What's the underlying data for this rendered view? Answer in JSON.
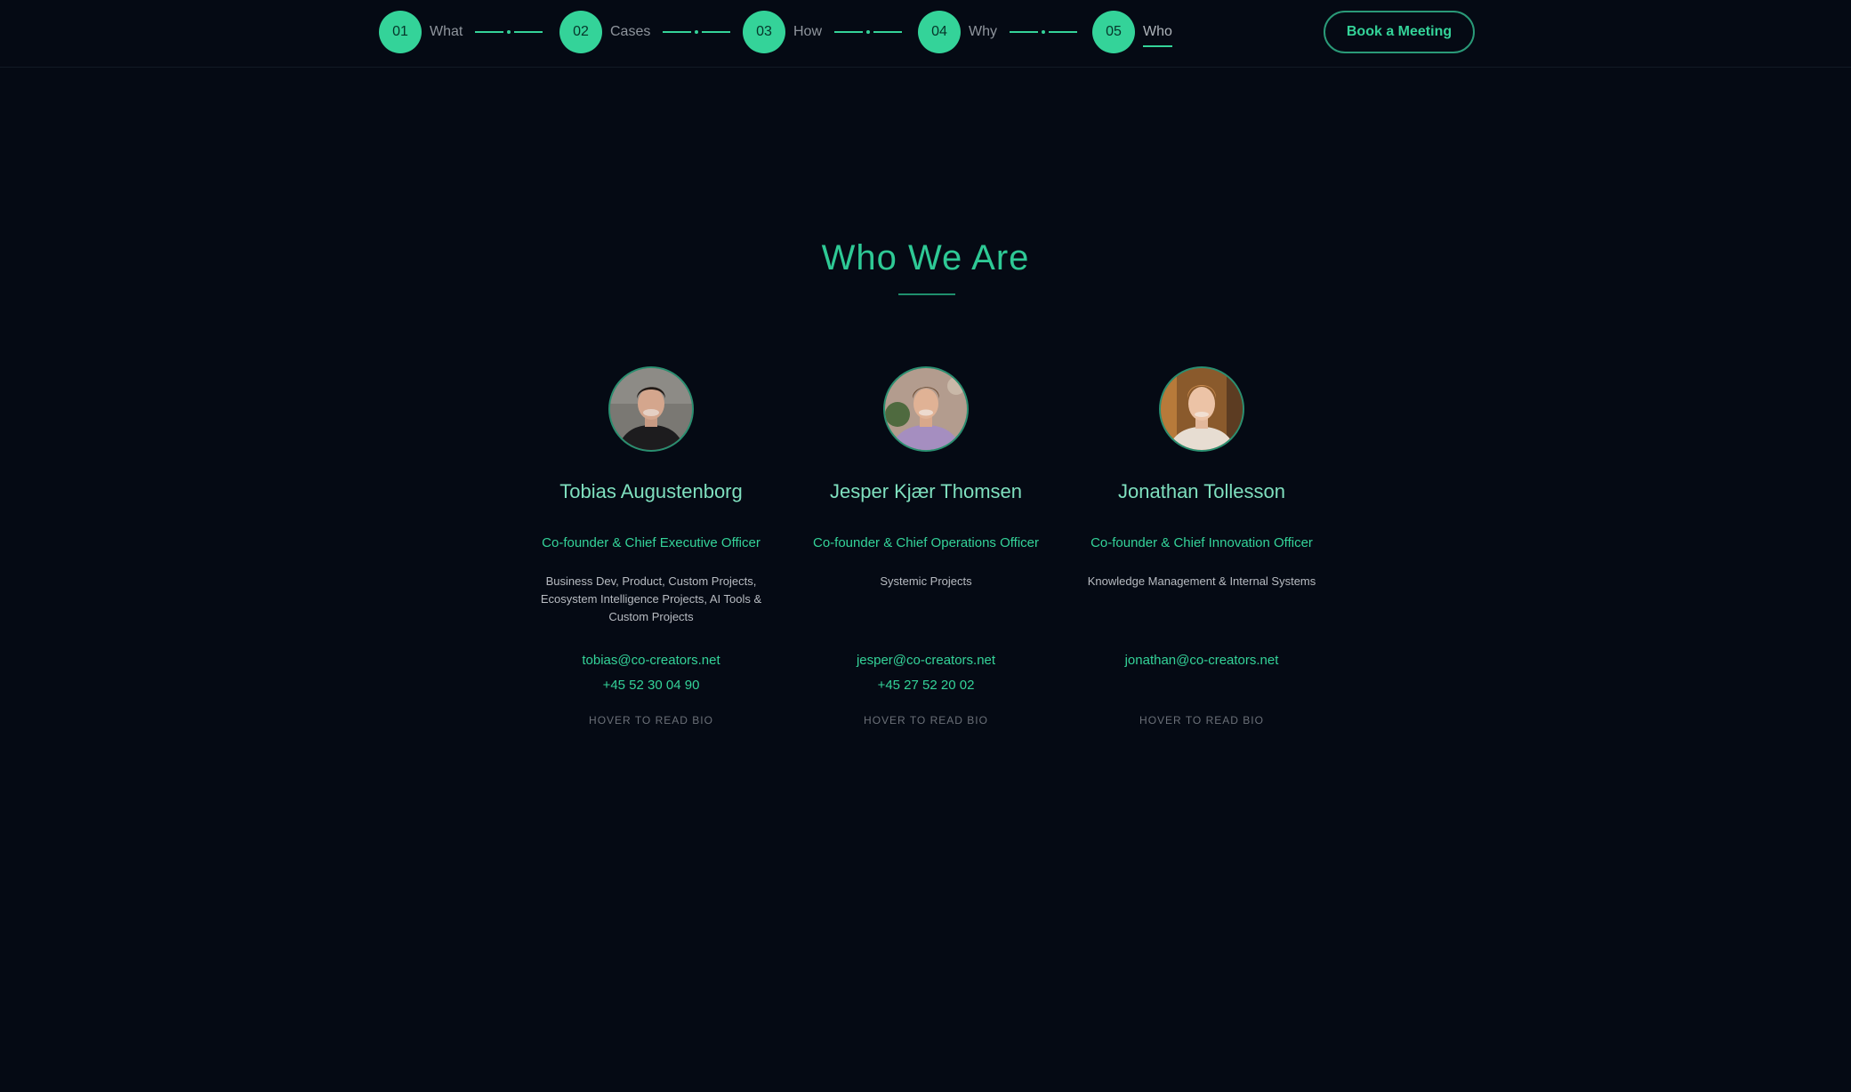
{
  "nav": {
    "steps": [
      {
        "number": "01",
        "label": "What"
      },
      {
        "number": "02",
        "label": "Cases"
      },
      {
        "number": "03",
        "label": "How"
      },
      {
        "number": "04",
        "label": "Why"
      },
      {
        "number": "05",
        "label": "Who"
      }
    ],
    "active_step": "Who",
    "cta_label": "Book a Meeting"
  },
  "section": {
    "title": "Who We Are"
  },
  "team": [
    {
      "name": "Tobias Augustenborg",
      "role": "Co-founder & Chief Executive Officer",
      "focus": "Business Dev, Product, Custom Projects, Ecosystem Intelligence Projects, AI Tools & Custom Projects",
      "email": "tobias@co-creators.net",
      "phone": "+45 52 30 04 90",
      "hint": "HOVER TO READ BIO"
    },
    {
      "name": "Jesper Kjær Thomsen",
      "role": "Co-founder & Chief Operations Officer",
      "focus": "Systemic Projects",
      "email": "jesper@co-creators.net",
      "phone": "+45 27 52 20 02",
      "hint": "HOVER TO READ BIO"
    },
    {
      "name": "Jonathan Tollesson",
      "role": "Co-founder & Chief Innovation Officer",
      "focus": "Knowledge Management & Internal Systems",
      "email": "jonathan@co-creators.net",
      "hint": "HOVER TO READ BIO"
    }
  ],
  "colors": {
    "background": "#050a14",
    "accent": "#34d399",
    "muted_text": "#8f959d"
  }
}
